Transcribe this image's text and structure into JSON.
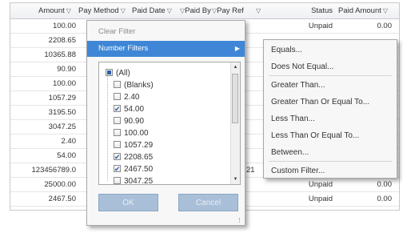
{
  "grid": {
    "headers": {
      "amount": "Amount",
      "pay_method": "Pay Method",
      "paid_date": "Paid Date",
      "paid_by": "Paid By",
      "pay_ref": "Pay Ref",
      "status": "Status",
      "paid_amount": "Paid Amount"
    },
    "rows": [
      {
        "amount": "100.00",
        "extra": "",
        "status": "Unpaid",
        "paid_amount": "0.00"
      },
      {
        "amount": "2208.65",
        "extra": "",
        "status": "",
        "paid_amount": ""
      },
      {
        "amount": "10365.88",
        "extra": "",
        "status": "",
        "paid_amount": ""
      },
      {
        "amount": "90.90",
        "extra": "",
        "status": "",
        "paid_amount": ""
      },
      {
        "amount": "100.00",
        "extra": "",
        "status": "",
        "paid_amount": ""
      },
      {
        "amount": "1057.29",
        "extra": "",
        "status": "",
        "paid_amount": ""
      },
      {
        "amount": "3195.50",
        "extra": "",
        "status": "",
        "paid_amount": ""
      },
      {
        "amount": "3047.25",
        "extra": "",
        "status": "",
        "paid_amount": ""
      },
      {
        "amount": "2.40",
        "extra": "",
        "status": "",
        "paid_amount": ""
      },
      {
        "amount": "54.00",
        "extra": "",
        "status": "",
        "paid_amount": ""
      },
      {
        "amount": "123456789.0",
        "extra": "21",
        "status": "Paid",
        "paid_amount": "123456789.02"
      },
      {
        "amount": "25000.00",
        "extra": "",
        "status": "Unpaid",
        "paid_amount": "0.00"
      },
      {
        "amount": "2467.50",
        "extra": "",
        "status": "Unpaid",
        "paid_amount": "0.00"
      }
    ]
  },
  "filter_menu": {
    "clear_filter": "Clear Filter",
    "number_filters": "Number Filters",
    "values": [
      {
        "label": "(All)",
        "state": "indeterminate"
      },
      {
        "label": "(Blanks)",
        "state": "unchecked"
      },
      {
        "label": "2.40",
        "state": "unchecked"
      },
      {
        "label": "54.00",
        "state": "checked"
      },
      {
        "label": "90.90",
        "state": "unchecked"
      },
      {
        "label": "100.00",
        "state": "unchecked"
      },
      {
        "label": "1057.29",
        "state": "unchecked"
      },
      {
        "label": "2208.65",
        "state": "checked"
      },
      {
        "label": "2467.50",
        "state": "checked"
      },
      {
        "label": "3047.25",
        "state": "unchecked"
      }
    ],
    "ok_label": "OK",
    "cancel_label": "Cancel"
  },
  "number_filters_submenu": {
    "items": [
      "Equals...",
      "Does Not Equal...",
      "Greater Than...",
      "Greater Than Or Equal To...",
      "Less Than...",
      "Less Than Or Equal To...",
      "Between...",
      "Custom Filter..."
    ]
  },
  "colors": {
    "highlight": "#3f87d6",
    "button": "#a9bfd8",
    "check": "#2a5fa8"
  }
}
